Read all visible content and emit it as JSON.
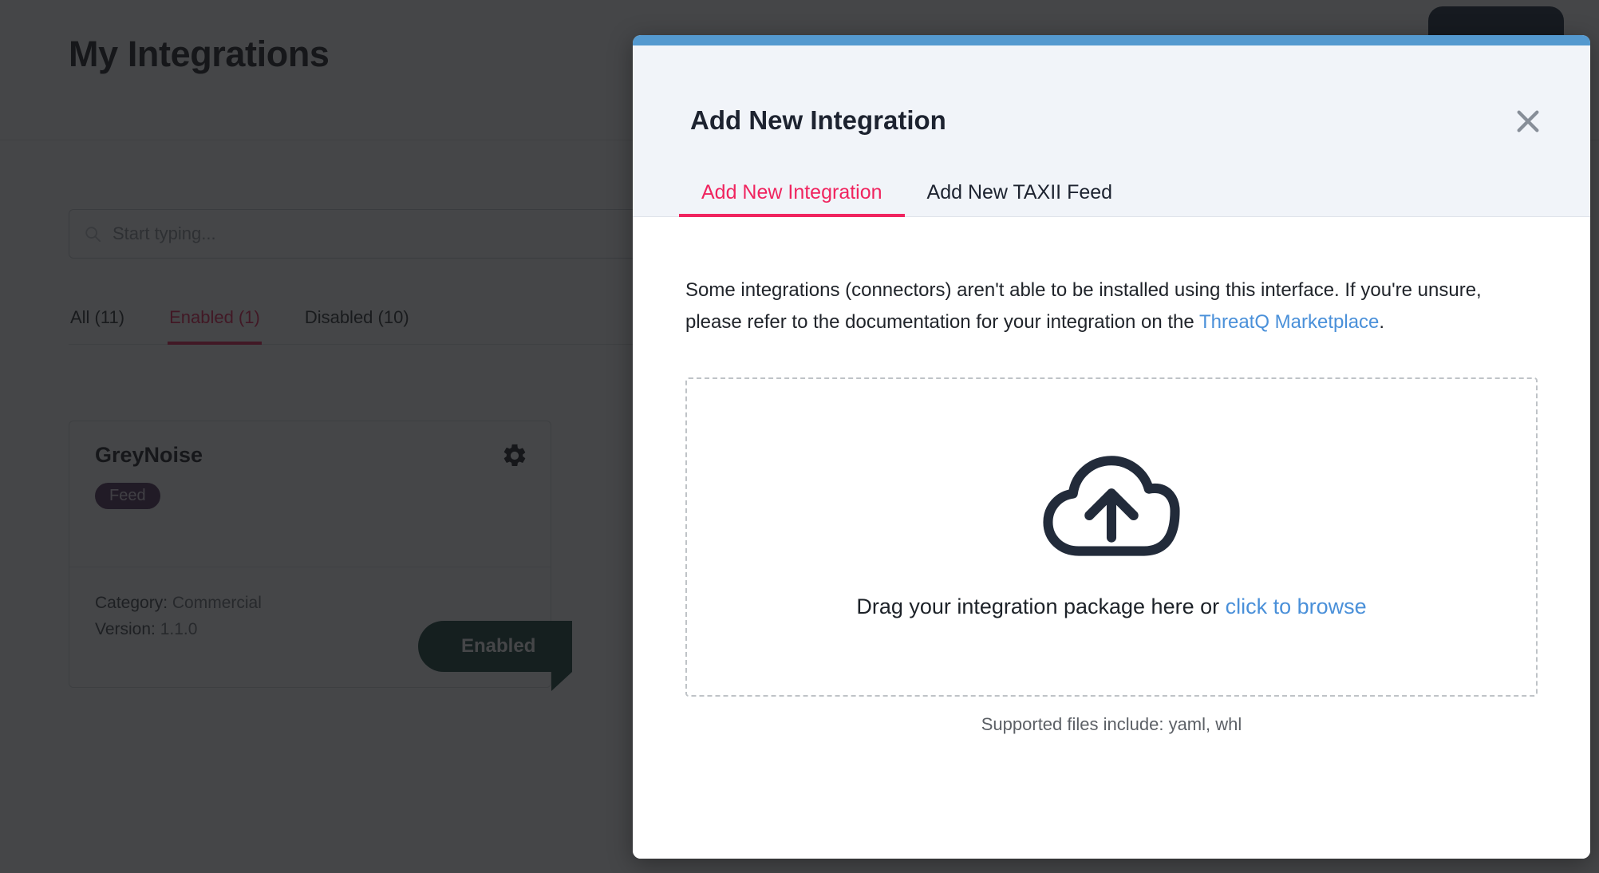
{
  "page": {
    "title": "My Integrations",
    "new_integration_button_label": "",
    "search": {
      "placeholder": "Start typing...",
      "value": "",
      "icon": "search-icon"
    },
    "tabs": [
      {
        "label": "All (11)",
        "active": false
      },
      {
        "label": "Enabled (1)",
        "active": true
      },
      {
        "label": "Disabled (10)",
        "active": false
      }
    ],
    "card": {
      "title": "GreyNoise",
      "badge": "Feed",
      "gear_icon": "gear-icon",
      "category_label": "Category:",
      "category_value": "Commercial",
      "version_label": "Version:",
      "version_value": "1.1.0",
      "status_ribbon": "Enabled"
    }
  },
  "modal": {
    "title": "Add New Integration",
    "close_icon": "close-icon",
    "tabs": [
      {
        "label": "Add New Integration",
        "active": true
      },
      {
        "label": "Add New TAXII Feed",
        "active": false
      }
    ],
    "intro": {
      "text_before_link": "Some integrations (connectors) aren't able to be installed using this interface. If you're unsure, please refer to the documentation for your integration on the ",
      "link_text": "ThreatQ Marketplace",
      "text_after_link": "."
    },
    "dropzone": {
      "icon": "cloud-upload-icon",
      "text_before_link": "Drag your integration package here or ",
      "link_text": "click to browse",
      "supported_files": "Supported files include: yaml, whl"
    }
  },
  "colors": {
    "accent_pink": "#f0245f",
    "tab_pink": "#e8194f",
    "modal_topbar_blue": "#5499cf",
    "link_blue": "#4a90d9",
    "feed_badge_purple": "#4c2a54",
    "enabled_green": "#0f3d35",
    "overlay": "rgba(22,24,26,0.80)"
  }
}
